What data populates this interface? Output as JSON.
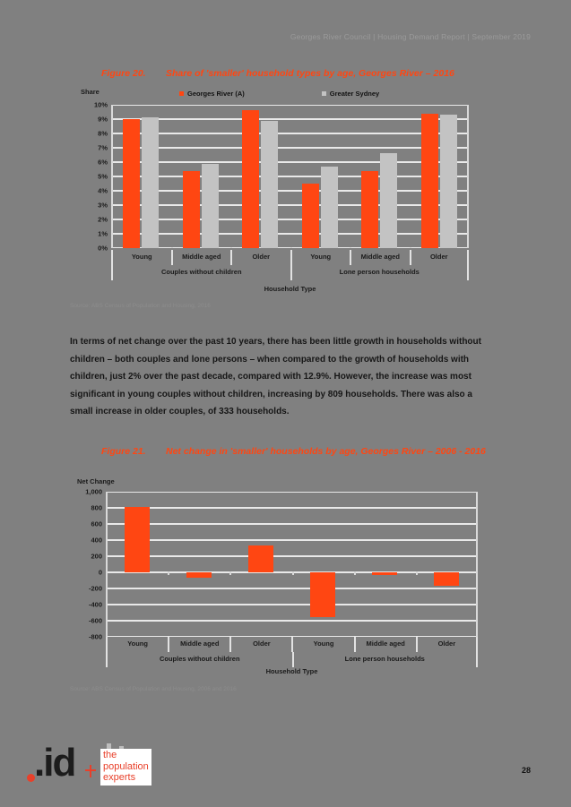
{
  "header": {
    "running_text": "Georges River Council  |  Housing Demand Report  |  September 2019"
  },
  "figure20": {
    "number": "Figure 20.",
    "title": "Share of 'smaller' household types by age, Georges River – 2016",
    "ylabel": "Share",
    "xlabel": "Household Type",
    "source": "Source: ABS Census of Population and Housing, 2016",
    "legend": [
      {
        "label": "Georges River (A)",
        "color": "#ff4612"
      },
      {
        "label": "Greater Sydney",
        "color": "#c3c3c3"
      }
    ],
    "yticks": [
      "10%",
      "9%",
      "8%",
      "7%",
      "6%",
      "5%",
      "4%",
      "3%",
      "2%",
      "1%",
      "0%"
    ],
    "groups": [
      {
        "label": "Couples without children"
      },
      {
        "label": "Lone person households"
      }
    ],
    "categories": [
      "Young",
      "Middle aged",
      "Older",
      "Young",
      "Middle aged",
      "Older"
    ]
  },
  "figure21": {
    "number": "Figure 21.",
    "title": "Net change in 'smaller' households by age, Georges River – 2006 - 2016",
    "ylabel": "Net Change",
    "xlabel": "Household Type",
    "source": "Source: ABS Census of Population and Housing, 2006 and 2016",
    "yticks": [
      "1,000",
      "800",
      "600",
      "400",
      "200",
      "0",
      "-200",
      "-400",
      "-600",
      "-800"
    ],
    "groups": [
      {
        "label": "Couples without children"
      },
      {
        "label": "Lone person households"
      }
    ],
    "categories": [
      "Young",
      "Middle aged",
      "Older",
      "Young",
      "Middle aged",
      "Older"
    ]
  },
  "body": {
    "paragraph": "In terms of net change over the past 10 years, there has been little growth in households without children – both couples and lone persons – when compared to the growth of households with children, just 2% over the past decade, compared with 12.9%. However, the increase was most significant in young couples without children, increasing by 809 households. There was also a small increase in older couples, of 333 households."
  },
  "logo": {
    "mark": ".id",
    "line1": "the",
    "line2": "population",
    "line3": "experts"
  },
  "footer": {
    "page_number": "28"
  },
  "chart_data": [
    {
      "type": "bar",
      "title": "Share of 'smaller' household types by age, Georges River – 2016",
      "xlabel": "Household Type",
      "ylabel": "Share",
      "ylim": [
        0,
        10
      ],
      "ytick_values": [
        0,
        1,
        2,
        3,
        4,
        5,
        6,
        7,
        8,
        9,
        10
      ],
      "ytick_labels": [
        "0%",
        "1%",
        "2%",
        "3%",
        "4%",
        "5%",
        "6%",
        "7%",
        "8%",
        "9%",
        "10%"
      ],
      "grid": true,
      "legend_position": "top",
      "categories": [
        "Young",
        "Middle aged",
        "Older",
        "Young",
        "Middle aged",
        "Older"
      ],
      "category_groups": [
        "Couples without children",
        "Couples without children",
        "Couples without children",
        "Lone person households",
        "Lone person households",
        "Lone person households"
      ],
      "series": [
        {
          "name": "Georges River (A)",
          "color": "#ff4612",
          "values": [
            9.0,
            5.4,
            9.6,
            4.5,
            5.4,
            9.4
          ]
        },
        {
          "name": "Greater Sydney",
          "color": "#c3c3c3",
          "values": [
            9.1,
            5.9,
            8.9,
            5.7,
            6.6,
            9.3
          ]
        }
      ]
    },
    {
      "type": "bar",
      "title": "Net change in 'smaller' households by age, Georges River – 2006 - 2016",
      "xlabel": "Household Type",
      "ylabel": "Net Change",
      "ylim": [
        -800,
        1000
      ],
      "ytick_values": [
        -800,
        -600,
        -400,
        -200,
        0,
        200,
        400,
        600,
        800,
        1000
      ],
      "ytick_labels": [
        "-800",
        "-600",
        "-400",
        "-200",
        "0",
        "200",
        "400",
        "600",
        "800",
        "1,000"
      ],
      "grid": true,
      "legend_position": "none",
      "categories": [
        "Young",
        "Middle aged",
        "Older",
        "Young",
        "Middle aged",
        "Older"
      ],
      "category_groups": [
        "Couples without children",
        "Couples without children",
        "Couples without children",
        "Lone person households",
        "Lone person households",
        "Lone person households"
      ],
      "series": [
        {
          "name": "Georges River (A)",
          "color": "#ff4612",
          "values": [
            809,
            -65,
            333,
            -550,
            -35,
            -170
          ]
        }
      ]
    }
  ]
}
